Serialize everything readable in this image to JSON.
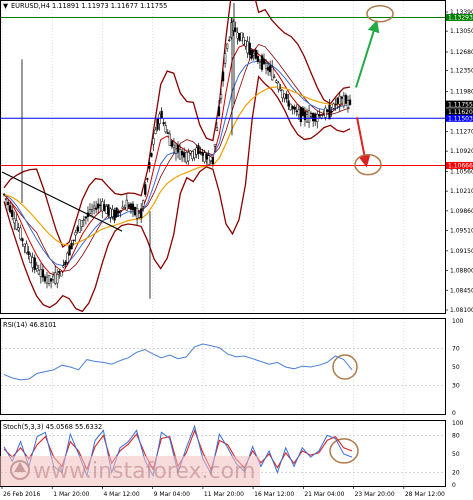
{
  "colors": {
    "candle": "#000000",
    "bollinger": "#8b0000",
    "ma_fast": "#cc0000",
    "ma_mid": "#3a6fd8",
    "ma_slow": "#f0a000",
    "trend": "#000000",
    "support_line": "#0000ff",
    "resistance_line": "#ff0000",
    "target_line": "#008000",
    "arrow_up": "#22aa44",
    "arrow_down": "#dd2222",
    "circle": "#b07a4a",
    "rsi": "#4a7fd8",
    "stoch_main": "#3a6fd8",
    "stoch_signal": "#dd2222",
    "watermark_band": "#f2c0c0"
  },
  "chart_data": [
    {
      "type": "candlestick",
      "title": "EURUSD,H4  1.11891 1.11973 1.11677 1.11755",
      "symbol": "EURUSD,H4",
      "ohlc_header": [
        "1.11891",
        "1.11973",
        "1.11677",
        "1.11755"
      ],
      "ylim": [
        1.081,
        1.1355
      ],
      "price_ticks": [
        "1.13390",
        "1.13050",
        "1.12680",
        "1.12350",
        "1.11980",
        "1.11270",
        "1.10920",
        "1.10560",
        "1.10210",
        "1.09860",
        "1.09510",
        "1.09150",
        "1.08800",
        "1.08450",
        "1.08100"
      ],
      "price_tick_values": [
        1.1339,
        1.1305,
        1.1268,
        1.1235,
        1.1198,
        1.1127,
        1.1092,
        1.1056,
        1.1021,
        1.0986,
        1.0951,
        1.0915,
        1.088,
        1.0845,
        1.081
      ],
      "x_labels": [
        "26 Feb 2016",
        "1 Mar 20:00",
        "4 Mar 12:00",
        "9 Mar 04:00",
        "11 Mar 20:00",
        "16 Mar 12:00",
        "21 Mar 04:00",
        "23 Mar 20:00",
        "28 Mar 12:00"
      ],
      "price_labels": [
        {
          "value": 1.13293,
          "text": "1.13293",
          "color": "#008000"
        },
        {
          "value": 1.11755,
          "text": "1.11755",
          "color": "#000000"
        },
        {
          "value": 1.1162,
          "text": "1.11620",
          "color": "#000000"
        },
        {
          "value": 1.11503,
          "text": "1.11503",
          "color": "#0000ff"
        },
        {
          "value": 1.10666,
          "text": "1.10666",
          "color": "#ff0000"
        }
      ],
      "horizontal_levels": [
        {
          "name": "target",
          "value": 1.13293
        },
        {
          "name": "support",
          "value": 1.11503
        },
        {
          "name": "resistance",
          "value": 1.10666
        }
      ],
      "close_path": [
        1.1015,
        1.099,
        1.096,
        1.093,
        1.0905,
        1.0885,
        1.087,
        1.0862,
        1.0868,
        1.0882,
        1.0915,
        1.0945,
        1.0968,
        1.098,
        1.0992,
        1.0998,
        1.0985,
        1.0978,
        1.099,
        1.0998,
        1.0985,
        1.0978,
        1.1045,
        1.1115,
        1.116,
        1.1125,
        1.11,
        1.109,
        1.1085,
        1.109,
        1.1092,
        1.108,
        1.1075,
        1.1165,
        1.127,
        1.1315,
        1.1298,
        1.1285,
        1.1265,
        1.1255,
        1.1245,
        1.1232,
        1.1212,
        1.119,
        1.117,
        1.116,
        1.1155,
        1.1153,
        1.1154,
        1.1158,
        1.1162,
        1.1178,
        1.1185,
        1.1176
      ]
    },
    {
      "type": "line",
      "title": "RSI(14) 46.8101",
      "ylim": [
        0,
        100
      ],
      "ticks": [
        "100",
        "70",
        "50",
        "30",
        "0"
      ],
      "tick_values": [
        100,
        70,
        50,
        30,
        0
      ],
      "values": [
        42,
        38,
        36,
        37,
        43,
        45,
        47,
        52,
        50,
        47,
        58,
        56,
        55,
        53,
        57,
        60,
        66,
        69,
        64,
        60,
        63,
        59,
        61,
        72,
        75,
        73,
        71,
        64,
        61,
        62,
        59,
        56,
        53,
        55,
        50,
        48,
        51,
        50,
        52,
        55,
        62,
        58,
        47
      ]
    },
    {
      "type": "line",
      "title": "Stoch(5,3,3) 45.0568 55.6332",
      "ylim": [
        0,
        100
      ],
      "ticks": [
        "100",
        "80",
        "50",
        "20",
        "0"
      ],
      "tick_values": [
        100,
        80,
        50,
        20,
        0
      ],
      "series": [
        {
          "name": "main",
          "values": [
            62,
            38,
            70,
            30,
            78,
            85,
            30,
            20,
            82,
            50,
            15,
            72,
            88,
            20,
            60,
            70,
            88,
            40,
            15,
            85,
            75,
            20,
            60,
            95,
            42,
            18,
            82,
            60,
            35,
            22,
            62,
            30,
            55,
            20,
            60,
            30,
            60,
            45,
            55,
            80,
            75,
            50,
            45
          ]
        },
        {
          "name": "signal",
          "values": [
            58,
            45,
            60,
            42,
            65,
            78,
            45,
            30,
            70,
            55,
            25,
            62,
            80,
            35,
            55,
            66,
            82,
            50,
            25,
            75,
            78,
            30,
            52,
            88,
            52,
            25,
            72,
            65,
            42,
            28,
            55,
            36,
            50,
            28,
            52,
            35,
            55,
            48,
            52,
            72,
            78,
            60,
            55
          ]
        }
      ]
    }
  ],
  "watermark": {
    "text": "www.instaforex.com"
  }
}
